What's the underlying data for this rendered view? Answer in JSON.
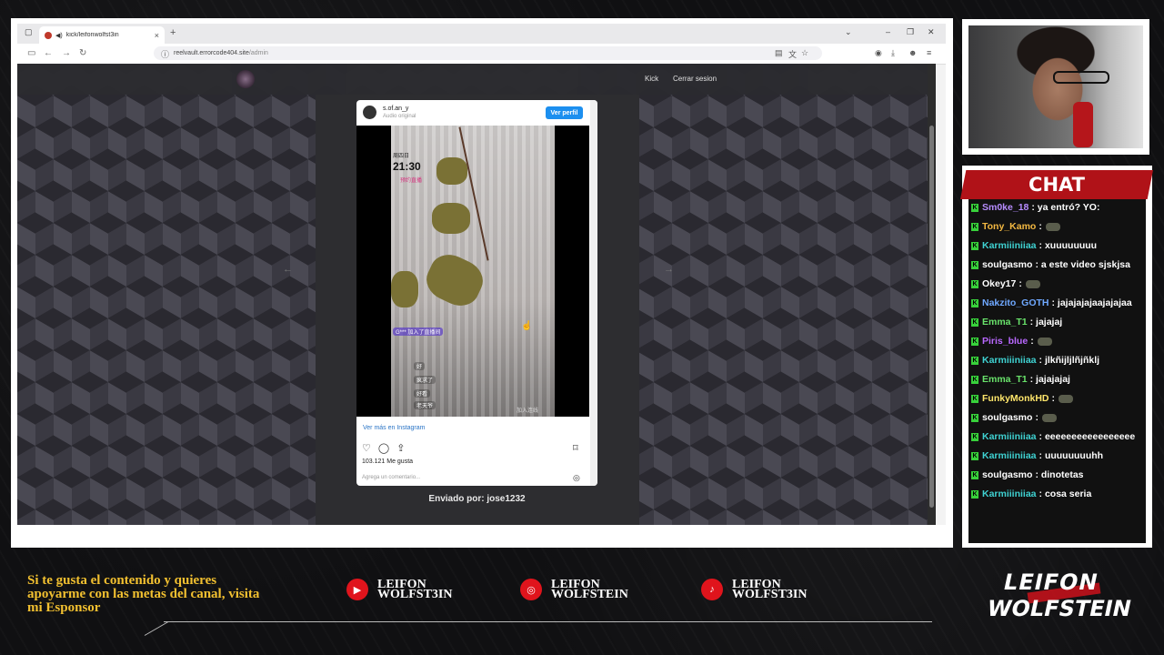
{
  "browser": {
    "tab_title": "kick/leifonwolfst3in",
    "new_tab": "+",
    "tab_close": "×",
    "url_domain": "reelvault.errorcode404.site",
    "url_path": "/admin",
    "window_minimize": "–",
    "window_restore": "❐",
    "window_close": "✕"
  },
  "site": {
    "nav_kick": "Kick",
    "nav_logout": "Cerrar sesion",
    "sent_by": "Enviado por: jose1232",
    "prev_arrow": "←",
    "next_arrow": "→"
  },
  "instagram": {
    "username": "s.of.an_y",
    "audio": "Audio original",
    "view_profile": "Ver perfil",
    "video_time": "21:30",
    "video_weekday": "周四日",
    "video_pink": "预约直播",
    "video_join": "G*** 加入了直播间",
    "video_comment_1": "好",
    "video_comment_2": "疯求了",
    "video_comment_3": "好看",
    "video_comment_4": "老天爷",
    "video_watermark": "加入连线",
    "see_more": "Ver más en Instagram",
    "likes": "103.121 Me gusta",
    "comment_placeholder": "Agrega un comentario..."
  },
  "chat": {
    "title": "CHAT",
    "messages": [
      {
        "user": "Sm0ke_18",
        "text": ": ya entró? YO:",
        "color": "#b68cff"
      },
      {
        "user": "Tony_Kamo",
        "text": ":",
        "color": "#f4b942"
      },
      {
        "user": "Karmiiiniiaa",
        "text": ": xuuuuuuuu",
        "color": "#3fd2d2"
      },
      {
        "user": "soulgasmo",
        "text": ": a este video sjskjsa",
        "color": "#ffffff"
      },
      {
        "user": "Okey17",
        "text": ":",
        "color": "#ffffff"
      },
      {
        "user": "Nakzito_GOTH",
        "text": ": jajajajajaajajajaa",
        "color": "#6fa8ff"
      },
      {
        "user": "Emma_T1",
        "text": ": jajajaj",
        "color": "#69e36b"
      },
      {
        "user": "Piris_blue",
        "text": ":",
        "color": "#b968ff"
      },
      {
        "user": "Karmiiiniiaa",
        "text": ": jlkñijljlñjñklj",
        "color": "#3fd2d2"
      },
      {
        "user": "Emma_T1",
        "text": ": jajajajaj",
        "color": "#69e36b"
      },
      {
        "user": "FunkyMonkHD",
        "text": ":",
        "color": "#ffe66b"
      },
      {
        "user": "soulgasmo",
        "text": ":",
        "color": "#ffffff"
      },
      {
        "user": "Karmiiiniiaa",
        "text": ": eeeeeeeeeeeeeeeee",
        "color": "#3fd2d2"
      },
      {
        "user": "Karmiiiniiaa",
        "text": ": uuuuuuuuhh",
        "color": "#3fd2d2"
      },
      {
        "user": "soulgasmo",
        "text": ": dinotetas",
        "color": "#ffffff"
      },
      {
        "user": "Karmiiiniiaa",
        "text": ": cosa seria",
        "color": "#3fd2d2"
      }
    ]
  },
  "footer": {
    "promo": "Si te gusta el contenido y quieres apoyarme con las metas del canal, visita mi Esponsor",
    "youtube_line1": "LEIFON",
    "youtube_line2": "WOLFST3IN",
    "instagram_line1": "LEIFON",
    "instagram_line2": "WOLFSTEIN",
    "tiktok_line1": "LEIFON",
    "tiktok_line2": "WOLFST3IN",
    "brand_line1": "LEIFON",
    "brand_line2": "WOLFSTEIN"
  }
}
